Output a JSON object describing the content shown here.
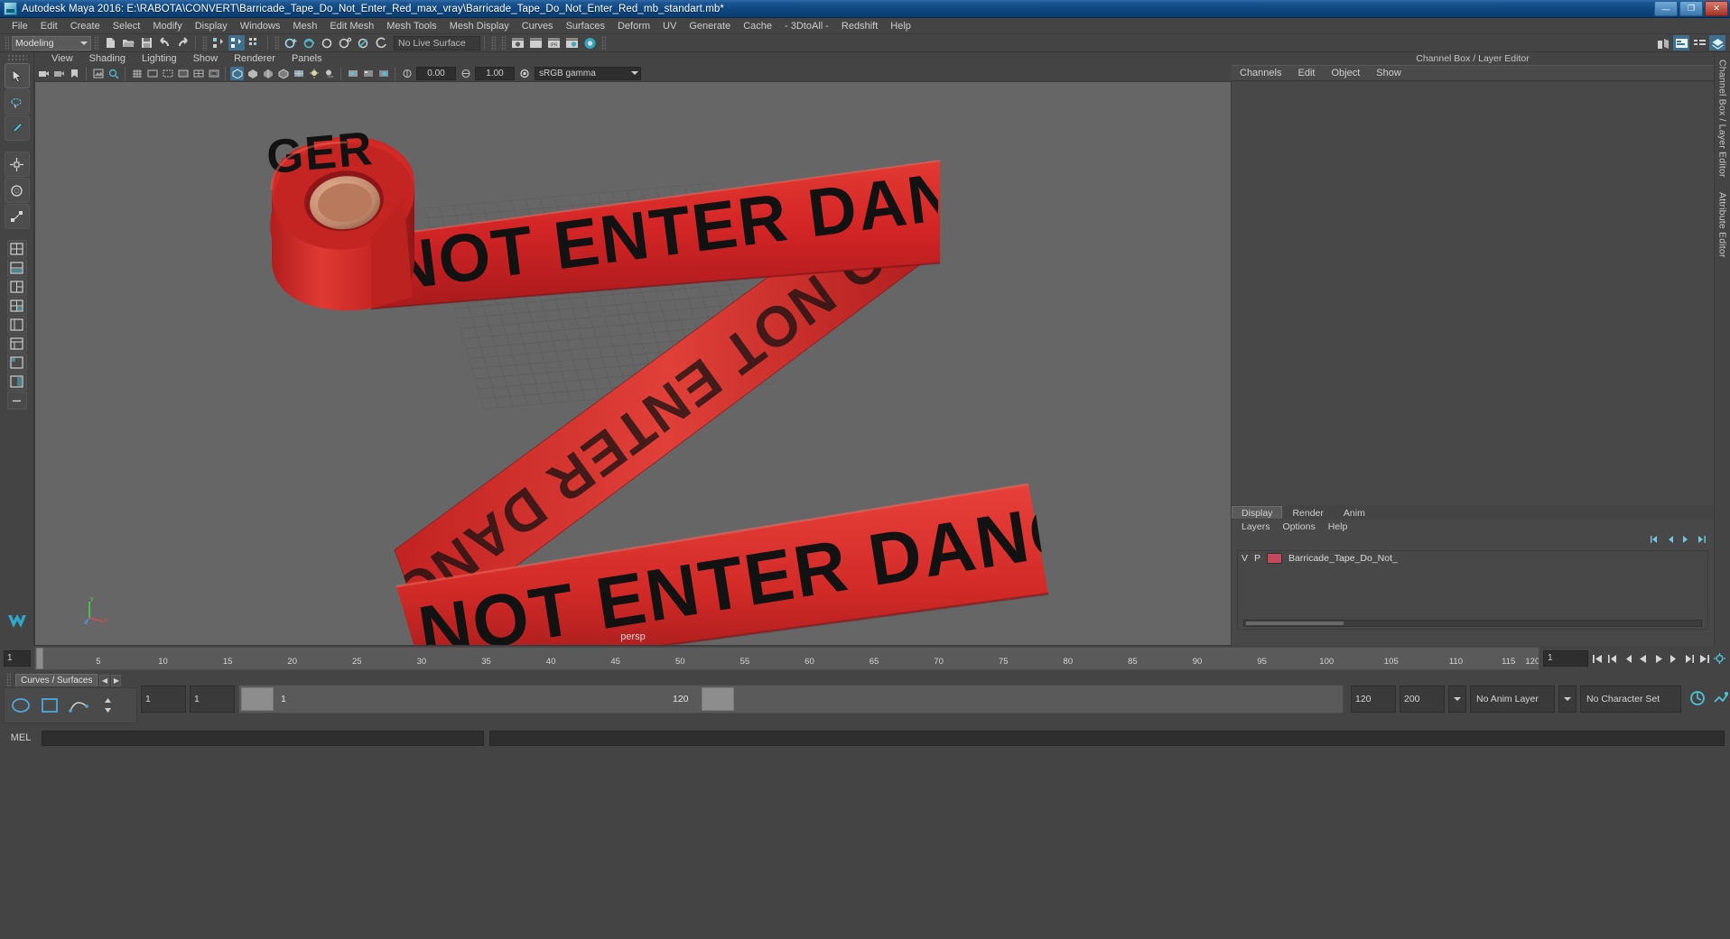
{
  "window": {
    "title": "Autodesk Maya 2016: E:\\RABOTA\\CONVERT\\Barricade_Tape_Do_Not_Enter_Red_max_vray\\Barricade_Tape_Do_Not_Enter_Red_mb_standart.mb*",
    "minimize_label": "—",
    "maximize_label": "❐",
    "close_label": "✕"
  },
  "menubar": {
    "items": [
      {
        "label": "File"
      },
      {
        "label": "Edit"
      },
      {
        "label": "Create"
      },
      {
        "label": "Select"
      },
      {
        "label": "Modify"
      },
      {
        "label": "Display"
      },
      {
        "label": "Windows"
      },
      {
        "label": "Mesh"
      },
      {
        "label": "Edit Mesh"
      },
      {
        "label": "Mesh Tools"
      },
      {
        "label": "Mesh Display"
      },
      {
        "label": "Curves"
      },
      {
        "label": "Surfaces"
      },
      {
        "label": "Deform"
      },
      {
        "label": "UV"
      },
      {
        "label": "Generate"
      },
      {
        "label": "Cache"
      },
      {
        "label": "- 3DtoAll -"
      },
      {
        "label": "Redshift"
      },
      {
        "label": "Help"
      }
    ]
  },
  "statusline": {
    "menu_set": "Modeling",
    "live_surface": "No Live Surface"
  },
  "panel": {
    "menus": [
      {
        "label": "View"
      },
      {
        "label": "Shading"
      },
      {
        "label": "Lighting"
      },
      {
        "label": "Show"
      },
      {
        "label": "Renderer"
      },
      {
        "label": "Panels"
      }
    ],
    "exposure_value": "0.00",
    "gamma_value": "1.00",
    "color_profile": "sRGB gamma",
    "camera_label": "persp",
    "axis": {
      "x": "x",
      "y": "y",
      "z": "z"
    }
  },
  "rightdock": {
    "title": "Channel Box / Layer Editor",
    "tabs": [
      {
        "label": "Channels"
      },
      {
        "label": "Edit"
      },
      {
        "label": "Object"
      },
      {
        "label": "Show"
      }
    ],
    "vertical_tabs": [
      {
        "label": "Channel Box / Layer Editor"
      },
      {
        "label": "Attribute Editor"
      }
    ],
    "layer_tabs": [
      {
        "label": "Display",
        "selected": true
      },
      {
        "label": "Render",
        "selected": false
      },
      {
        "label": "Anim",
        "selected": false
      }
    ],
    "layer_menus": [
      {
        "label": "Layers"
      },
      {
        "label": "Options"
      },
      {
        "label": "Help"
      }
    ],
    "layers": [
      {
        "visible": "V",
        "playback": "P",
        "color": "#c4495f",
        "name": "Barricade_Tape_Do_Not_"
      }
    ]
  },
  "timeline": {
    "start_field": "1",
    "current_frame": "1",
    "ticks": [
      "5",
      "10",
      "15",
      "20",
      "25",
      "30",
      "35",
      "40",
      "45",
      "50",
      "55",
      "60",
      "65",
      "70",
      "75",
      "80",
      "85",
      "90",
      "95",
      "100",
      "105",
      "110",
      "115",
      "120"
    ],
    "range_min": 5,
    "range_max": 120
  },
  "range": {
    "anim_start": "1",
    "range_start": "1",
    "slider_start_label": "1",
    "slider_end_label": "120",
    "range_end": "120",
    "anim_end": "200",
    "anim_layer": "No Anim Layer",
    "character_set": "No Character Set"
  },
  "shelf": {
    "tab_label": "Curves / Surfaces",
    "prev_label": "◀",
    "next_label": "▶"
  },
  "mel": {
    "label": "MEL",
    "input_value": "",
    "output_value": ""
  },
  "viewport_scene": {
    "object_name": "Barricade_Tape_Do_Not_Enter_Red",
    "tape_text_upper": "NOT ENTER DANGER",
    "tape_text_roll": "GER",
    "tape_text_diagonal": "DO NOT ENTER DANGER",
    "tape_text_lower": "NOT ENTER DANGER",
    "tape_color": "#d62828",
    "tape_text_color": "#111111",
    "background_color": "#666666",
    "grid_color": "#595959"
  }
}
